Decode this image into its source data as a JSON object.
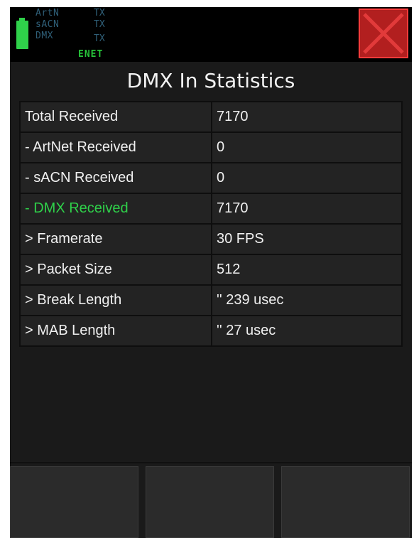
{
  "status": {
    "protocols": [
      {
        "name": "ArtN",
        "state": "TX"
      },
      {
        "name": "sACN",
        "state": "TX"
      },
      {
        "name": "DMX",
        "state": "TX"
      }
    ],
    "network": "ENET"
  },
  "colors": {
    "background": "#1a1a1a",
    "accent_green": "#2fd14a",
    "close_red": "#b21f1f"
  },
  "title": "DMX In Statistics",
  "stats": [
    {
      "label": "Total Received",
      "value": "7170"
    },
    {
      "label": "- ArtNet Received",
      "value": "0"
    },
    {
      "label": "- sACN Received",
      "value": "0"
    },
    {
      "label": "- DMX Received",
      "value": "7170",
      "highlight": true
    },
    {
      "label": "> Framerate",
      "value": "30 FPS"
    },
    {
      "label": "> Packet Size",
      "value": "512"
    },
    {
      "label": "> Break Length",
      "value": "'' 239 usec"
    },
    {
      "label": "> MAB Length",
      "value": "'' 27 usec"
    }
  ],
  "softkeys": [
    "",
    "",
    ""
  ]
}
